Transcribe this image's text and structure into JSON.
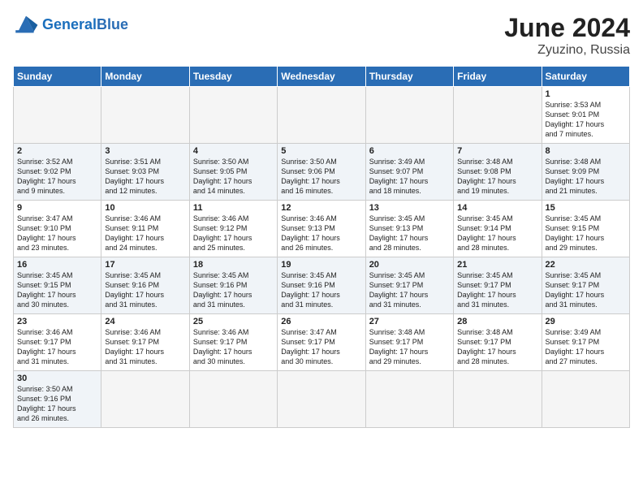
{
  "header": {
    "logo_general": "General",
    "logo_blue": "Blue",
    "month_year": "June 2024",
    "location": "Zyuzino, Russia"
  },
  "weekdays": [
    "Sunday",
    "Monday",
    "Tuesday",
    "Wednesday",
    "Thursday",
    "Friday",
    "Saturday"
  ],
  "weeks": [
    [
      {
        "day": "",
        "info": ""
      },
      {
        "day": "",
        "info": ""
      },
      {
        "day": "",
        "info": ""
      },
      {
        "day": "",
        "info": ""
      },
      {
        "day": "",
        "info": ""
      },
      {
        "day": "",
        "info": ""
      },
      {
        "day": "1",
        "info": "Sunrise: 3:53 AM\nSunset: 9:01 PM\nDaylight: 17 hours\nand 7 minutes."
      }
    ],
    [
      {
        "day": "2",
        "info": "Sunrise: 3:52 AM\nSunset: 9:02 PM\nDaylight: 17 hours\nand 9 minutes."
      },
      {
        "day": "3",
        "info": "Sunrise: 3:51 AM\nSunset: 9:03 PM\nDaylight: 17 hours\nand 12 minutes."
      },
      {
        "day": "4",
        "info": "Sunrise: 3:50 AM\nSunset: 9:05 PM\nDaylight: 17 hours\nand 14 minutes."
      },
      {
        "day": "5",
        "info": "Sunrise: 3:50 AM\nSunset: 9:06 PM\nDaylight: 17 hours\nand 16 minutes."
      },
      {
        "day": "6",
        "info": "Sunrise: 3:49 AM\nSunset: 9:07 PM\nDaylight: 17 hours\nand 18 minutes."
      },
      {
        "day": "7",
        "info": "Sunrise: 3:48 AM\nSunset: 9:08 PM\nDaylight: 17 hours\nand 19 minutes."
      },
      {
        "day": "8",
        "info": "Sunrise: 3:48 AM\nSunset: 9:09 PM\nDaylight: 17 hours\nand 21 minutes."
      }
    ],
    [
      {
        "day": "9",
        "info": "Sunrise: 3:47 AM\nSunset: 9:10 PM\nDaylight: 17 hours\nand 23 minutes."
      },
      {
        "day": "10",
        "info": "Sunrise: 3:46 AM\nSunset: 9:11 PM\nDaylight: 17 hours\nand 24 minutes."
      },
      {
        "day": "11",
        "info": "Sunrise: 3:46 AM\nSunset: 9:12 PM\nDaylight: 17 hours\nand 25 minutes."
      },
      {
        "day": "12",
        "info": "Sunrise: 3:46 AM\nSunset: 9:13 PM\nDaylight: 17 hours\nand 26 minutes."
      },
      {
        "day": "13",
        "info": "Sunrise: 3:45 AM\nSunset: 9:13 PM\nDaylight: 17 hours\nand 28 minutes."
      },
      {
        "day": "14",
        "info": "Sunrise: 3:45 AM\nSunset: 9:14 PM\nDaylight: 17 hours\nand 28 minutes."
      },
      {
        "day": "15",
        "info": "Sunrise: 3:45 AM\nSunset: 9:15 PM\nDaylight: 17 hours\nand 29 minutes."
      }
    ],
    [
      {
        "day": "16",
        "info": "Sunrise: 3:45 AM\nSunset: 9:15 PM\nDaylight: 17 hours\nand 30 minutes."
      },
      {
        "day": "17",
        "info": "Sunrise: 3:45 AM\nSunset: 9:16 PM\nDaylight: 17 hours\nand 31 minutes."
      },
      {
        "day": "18",
        "info": "Sunrise: 3:45 AM\nSunset: 9:16 PM\nDaylight: 17 hours\nand 31 minutes."
      },
      {
        "day": "19",
        "info": "Sunrise: 3:45 AM\nSunset: 9:16 PM\nDaylight: 17 hours\nand 31 minutes."
      },
      {
        "day": "20",
        "info": "Sunrise: 3:45 AM\nSunset: 9:17 PM\nDaylight: 17 hours\nand 31 minutes."
      },
      {
        "day": "21",
        "info": "Sunrise: 3:45 AM\nSunset: 9:17 PM\nDaylight: 17 hours\nand 31 minutes."
      },
      {
        "day": "22",
        "info": "Sunrise: 3:45 AM\nSunset: 9:17 PM\nDaylight: 17 hours\nand 31 minutes."
      }
    ],
    [
      {
        "day": "23",
        "info": "Sunrise: 3:46 AM\nSunset: 9:17 PM\nDaylight: 17 hours\nand 31 minutes."
      },
      {
        "day": "24",
        "info": "Sunrise: 3:46 AM\nSunset: 9:17 PM\nDaylight: 17 hours\nand 31 minutes."
      },
      {
        "day": "25",
        "info": "Sunrise: 3:46 AM\nSunset: 9:17 PM\nDaylight: 17 hours\nand 30 minutes."
      },
      {
        "day": "26",
        "info": "Sunrise: 3:47 AM\nSunset: 9:17 PM\nDaylight: 17 hours\nand 30 minutes."
      },
      {
        "day": "27",
        "info": "Sunrise: 3:48 AM\nSunset: 9:17 PM\nDaylight: 17 hours\nand 29 minutes."
      },
      {
        "day": "28",
        "info": "Sunrise: 3:48 AM\nSunset: 9:17 PM\nDaylight: 17 hours\nand 28 minutes."
      },
      {
        "day": "29",
        "info": "Sunrise: 3:49 AM\nSunset: 9:17 PM\nDaylight: 17 hours\nand 27 minutes."
      }
    ],
    [
      {
        "day": "30",
        "info": "Sunrise: 3:50 AM\nSunset: 9:16 PM\nDaylight: 17 hours\nand 26 minutes."
      },
      {
        "day": "",
        "info": ""
      },
      {
        "day": "",
        "info": ""
      },
      {
        "day": "",
        "info": ""
      },
      {
        "day": "",
        "info": ""
      },
      {
        "day": "",
        "info": ""
      },
      {
        "day": "",
        "info": ""
      }
    ]
  ]
}
